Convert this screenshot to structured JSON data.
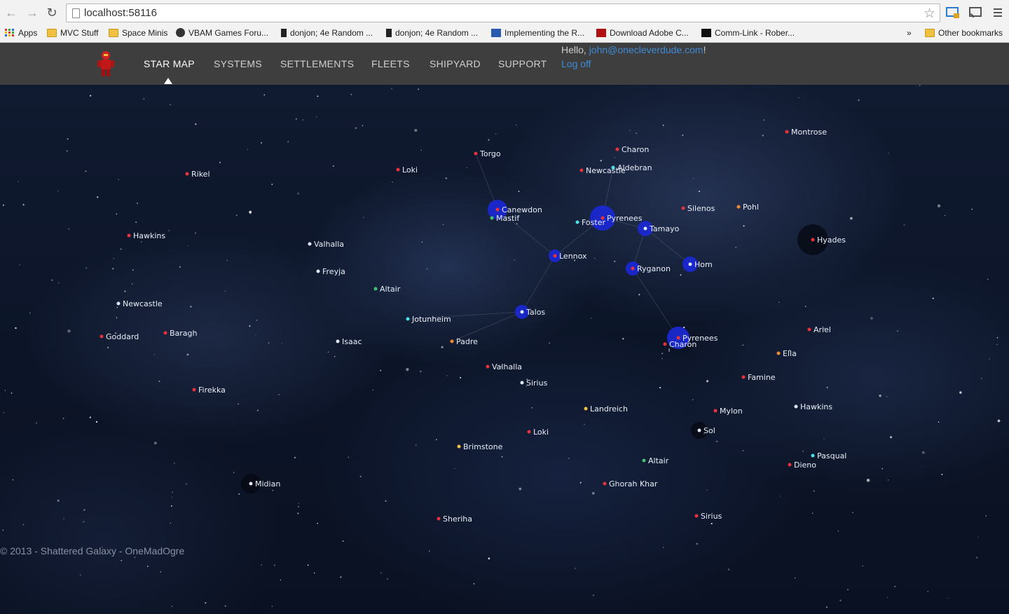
{
  "browser": {
    "url": "localhost:58116",
    "bookmarks": [
      {
        "label": "Apps",
        "icon": "apps-grid-icon"
      },
      {
        "label": "MVC Stuff",
        "icon": "folder-icon"
      },
      {
        "label": "Space Minis",
        "icon": "folder-icon"
      },
      {
        "label": "VBAM Games Foru...",
        "icon": "site-icon"
      },
      {
        "label": "donjon; 4e Random ...",
        "icon": "site-icon"
      },
      {
        "label": "donjon; 4e Random ...",
        "icon": "site-icon"
      },
      {
        "label": "Implementing the R...",
        "icon": "site-icon"
      },
      {
        "label": "Download Adobe C...",
        "icon": "site-icon"
      },
      {
        "label": "Comm-Link - Rober...",
        "icon": "site-icon"
      }
    ],
    "overflow_label": "»",
    "other_bookmarks": "Other bookmarks"
  },
  "header": {
    "nav": [
      "STAR MAP",
      "SYSTEMS",
      "SETTLEMENTS",
      "FLEETS",
      "SHIPYARD",
      "SUPPORT"
    ],
    "active_index": 0,
    "greeting_prefix": "Hello, ",
    "user_email": "john@onecleverdude.com",
    "greeting_suffix": "!",
    "logoff": "Log off"
  },
  "colors": {
    "accent": "#3f8bd6",
    "header_bg": "#3e3e3e",
    "system_red": "#e8323c",
    "system_white": "#dde6f5",
    "system_cyan": "#4fe0e8",
    "system_orange": "#f08a30",
    "system_yellow": "#f0c040",
    "system_green": "#40c070",
    "fleet_blue": "#1a28d0"
  },
  "systems": [
    {
      "name": "Montrose",
      "color": "red"
    },
    {
      "name": "Charon",
      "color": "red"
    },
    {
      "name": "Torgo",
      "color": "red"
    },
    {
      "name": "Rikel",
      "color": "red"
    },
    {
      "name": "Loki",
      "color": "red"
    },
    {
      "name": "Newcastle",
      "color": "red"
    },
    {
      "name": "Aldebran",
      "color": "cyan"
    },
    {
      "name": "Canewdon",
      "color": "red"
    },
    {
      "name": "Mastif",
      "color": "green"
    },
    {
      "name": "Silenos",
      "color": "red"
    },
    {
      "name": "Pohl",
      "color": "orange"
    },
    {
      "name": "Pyrenees",
      "color": "red"
    },
    {
      "name": "Foster",
      "color": "cyan"
    },
    {
      "name": "Tamayo",
      "color": "white"
    },
    {
      "name": "Hyades",
      "color": "red"
    },
    {
      "name": "Hawkins",
      "color": "red"
    },
    {
      "name": "Valhalla",
      "color": "white"
    },
    {
      "name": "Lennox",
      "color": "red"
    },
    {
      "name": "Hom",
      "color": "white"
    },
    {
      "name": "Ryganon",
      "color": "red"
    },
    {
      "name": "Freyja",
      "color": "white"
    },
    {
      "name": "Altair",
      "color": "green"
    },
    {
      "name": "Talos",
      "color": "white"
    },
    {
      "name": "Newcastle",
      "color": "white"
    },
    {
      "name": "Jotunheim",
      "color": "cyan"
    },
    {
      "name": "Ariel",
      "color": "red"
    },
    {
      "name": "Goddard",
      "color": "red"
    },
    {
      "name": "Baragh",
      "color": "red"
    },
    {
      "name": "Isaac",
      "color": "white"
    },
    {
      "name": "Padre",
      "color": "orange"
    },
    {
      "name": "Pyrenees",
      "color": "red"
    },
    {
      "name": "Charon",
      "color": "red"
    },
    {
      "name": "Ella",
      "color": "orange"
    },
    {
      "name": "Valhalla",
      "color": "red"
    },
    {
      "name": "Famine",
      "color": "red"
    },
    {
      "name": "Sirius",
      "color": "white"
    },
    {
      "name": "Firekka",
      "color": "red"
    },
    {
      "name": "Landreich",
      "color": "yellow"
    },
    {
      "name": "Mylon",
      "color": "red"
    },
    {
      "name": "Hawkins",
      "color": "white"
    },
    {
      "name": "Sol",
      "color": "white"
    },
    {
      "name": "Loki",
      "color": "red"
    },
    {
      "name": "Brimstone",
      "color": "yellow"
    },
    {
      "name": "Pasqual",
      "color": "cyan"
    },
    {
      "name": "Altair",
      "color": "green"
    },
    {
      "name": "Dieno",
      "color": "red"
    },
    {
      "name": "Midian",
      "color": "white"
    },
    {
      "name": "Ghorah Khar",
      "color": "red"
    },
    {
      "name": "Sirius",
      "color": "red"
    },
    {
      "name": "Sheriha",
      "color": "red"
    }
  ],
  "footer": "© 2013 - Shattered Galaxy - OneMadOgre"
}
